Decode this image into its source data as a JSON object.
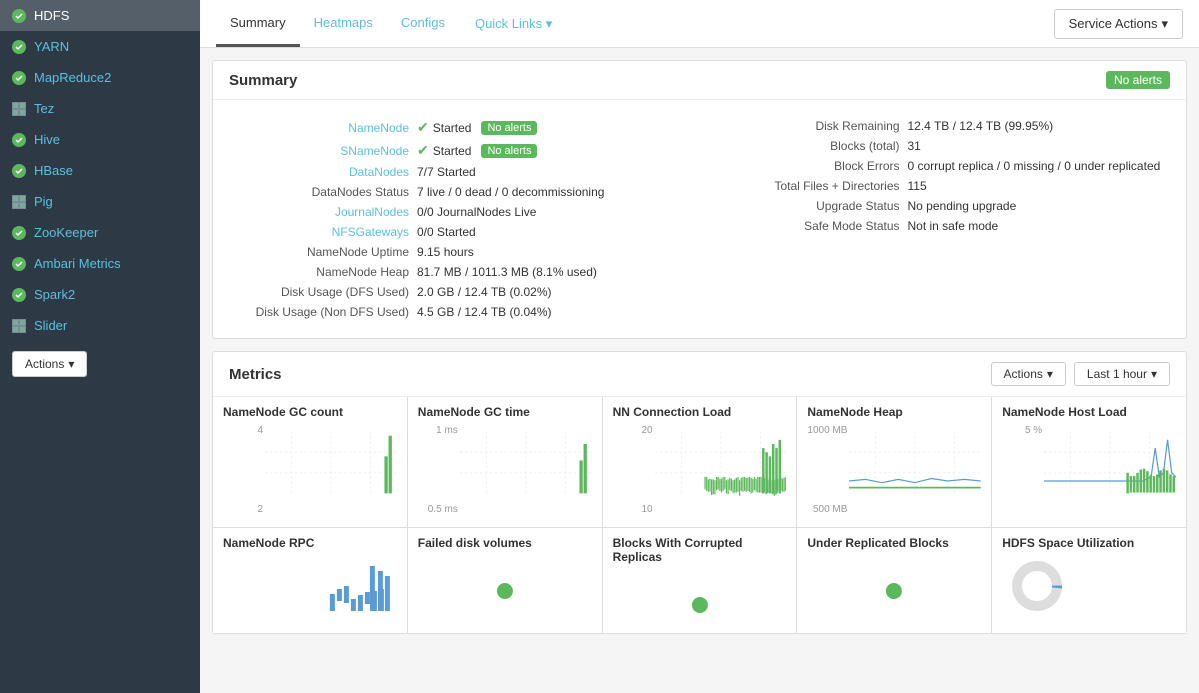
{
  "sidebar": {
    "items": [
      {
        "id": "hdfs",
        "label": "HDFS",
        "status": "green",
        "active": true,
        "icon": "circle"
      },
      {
        "id": "yarn",
        "label": "YARN",
        "status": "green",
        "active": false,
        "icon": "circle"
      },
      {
        "id": "mapreduce2",
        "label": "MapReduce2",
        "status": "green",
        "active": false,
        "icon": "circle"
      },
      {
        "id": "tez",
        "label": "Tez",
        "status": "none",
        "active": false,
        "icon": "square"
      },
      {
        "id": "hive",
        "label": "Hive",
        "status": "green",
        "active": false,
        "icon": "circle"
      },
      {
        "id": "hbase",
        "label": "HBase",
        "status": "green",
        "active": false,
        "icon": "circle"
      },
      {
        "id": "pig",
        "label": "Pig",
        "status": "none",
        "active": false,
        "icon": "square"
      },
      {
        "id": "zookeeper",
        "label": "ZooKeeper",
        "status": "green",
        "active": false,
        "icon": "circle"
      },
      {
        "id": "ambari-metrics",
        "label": "Ambari Metrics",
        "status": "green",
        "active": false,
        "icon": "circle"
      },
      {
        "id": "spark2",
        "label": "Spark2",
        "status": "green",
        "active": false,
        "icon": "circle"
      },
      {
        "id": "slider",
        "label": "Slider",
        "status": "none",
        "active": false,
        "icon": "square"
      }
    ],
    "actions_label": "Actions"
  },
  "tabs": [
    {
      "id": "summary",
      "label": "Summary",
      "active": true
    },
    {
      "id": "heatmaps",
      "label": "Heatmaps",
      "active": false
    },
    {
      "id": "configs",
      "label": "Configs",
      "active": false
    }
  ],
  "quick_links": "Quick Links ▾",
  "service_actions": "Service Actions",
  "summary": {
    "title": "Summary",
    "alert_badge": "No alerts",
    "left": {
      "rows": [
        {
          "label": "NameNode",
          "is_link": true,
          "value": "Started",
          "badge": "No alerts"
        },
        {
          "label": "SNameNode",
          "is_link": true,
          "value": "Started",
          "badge": "No alerts"
        },
        {
          "label": "DataNodes",
          "is_link": true,
          "value": "7/7 Started",
          "badge": null
        },
        {
          "label": "DataNodes Status",
          "is_link": false,
          "value": "7 live / 0 dead / 0 decommissioning",
          "badge": null
        },
        {
          "label": "JournalNodes",
          "is_link": true,
          "value": "0/0 JournalNodes Live",
          "badge": null
        },
        {
          "label": "NFSGateways",
          "is_link": true,
          "value": "0/0 Started",
          "badge": null
        },
        {
          "label": "NameNode Uptime",
          "is_link": false,
          "value": "9.15 hours",
          "badge": null
        },
        {
          "label": "NameNode Heap",
          "is_link": false,
          "value": "81.7 MB / 1011.3 MB (8.1% used)",
          "badge": null
        },
        {
          "label": "Disk Usage (DFS Used)",
          "is_link": false,
          "value": "2.0 GB / 12.4 TB (0.02%)",
          "badge": null
        },
        {
          "label": "Disk Usage (Non DFS Used)",
          "is_link": false,
          "value": "4.5 GB / 12.4 TB (0.04%)",
          "badge": null
        }
      ]
    },
    "right": {
      "rows": [
        {
          "label": "Disk Remaining",
          "value": "12.4 TB / 12.4 TB (99.95%)"
        },
        {
          "label": "Blocks (total)",
          "value": "31"
        },
        {
          "label": "Block Errors",
          "value": "0 corrupt replica / 0 missing / 0 under replicated"
        },
        {
          "label": "Total Files + Directories",
          "value": "115"
        },
        {
          "label": "Upgrade Status",
          "value": "No pending upgrade"
        },
        {
          "label": "Safe Mode Status",
          "value": "Not in safe mode"
        }
      ]
    }
  },
  "metrics": {
    "title": "Metrics",
    "actions_label": "Actions",
    "timerange_label": "Last 1 hour",
    "charts": [
      {
        "id": "namenode-gc-count",
        "title": "NameNode GC count",
        "y_labels": [
          "4",
          "2"
        ],
        "color": "green"
      },
      {
        "id": "namenode-gc-time",
        "title": "NameNode GC time",
        "y_labels": [
          "1 ms",
          "0.5 ms"
        ],
        "color": "green"
      },
      {
        "id": "nn-connection-load",
        "title": "NN Connection Load",
        "y_labels": [
          "20",
          "10"
        ],
        "color": "green"
      },
      {
        "id": "namenode-heap",
        "title": "NameNode Heap",
        "y_labels": [
          "1000 MB",
          "500 MB"
        ],
        "color": "green"
      },
      {
        "id": "namenode-host-load",
        "title": "NameNode Host Load",
        "y_labels": [
          "5 %"
        ],
        "color": "green"
      }
    ],
    "charts2": [
      {
        "id": "namenode-rpc",
        "title": "NameNode RPC"
      },
      {
        "id": "failed-disk-volumes",
        "title": "Failed disk volumes"
      },
      {
        "id": "blocks-corrupted",
        "title": "Blocks With Corrupted Replicas"
      },
      {
        "id": "under-replicated",
        "title": "Under Replicated Blocks"
      },
      {
        "id": "hdfs-space",
        "title": "HDFS Space Utilization"
      }
    ]
  }
}
